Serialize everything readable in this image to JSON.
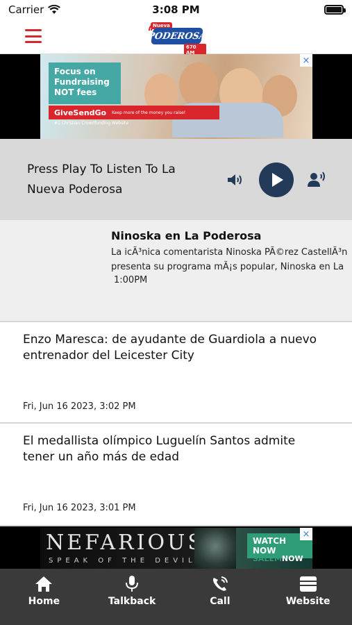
{
  "status_bar": {
    "carrier": "Carrier",
    "time": "3:08 PM"
  },
  "header": {
    "logo_top": "Nueva",
    "logo_main": "PODEROSA",
    "logo_freq": "670 AM",
    "brand_color": "#d8262c",
    "logo_color": "#1e4fa3"
  },
  "ad_top": {
    "headline": "Focus on Fundraising NOT fees",
    "brand": "GiveSendGo",
    "brand_sub": "#1 Christian Crowdfunding Website",
    "tagline": "Keep more of the money you raise!"
  },
  "player": {
    "prompt": "Press Play To Listen To La Nueva Poderosa",
    "button_color": "#233a59"
  },
  "show": {
    "title": "Ninoska en La Poderosa",
    "desc_line1": "La icÃ³nica comentarista Ninoska PÃ©rez CastellÃ³n",
    "desc_line2": "presenta su programa mÃ¡s popular, Ninoska en La",
    "time": "1:00PM"
  },
  "news": [
    {
      "title": "Enzo Maresca: de ayudante de Guardiola a nuevo entrenador del Leicester City",
      "date": "Fri, Jun 16 2023, 3:02 PM"
    },
    {
      "title": "El medallista olímpico Luguelín Santos admite tener un año más de edad",
      "date": "Fri, Jun 16 2023, 3:01 PM"
    }
  ],
  "ad_bottom": {
    "title": "NEFARIOUS",
    "subtitle": "SPEAK OF THE DEVIL",
    "cta": "WATCH NOW",
    "sponsor_a": "SALEM",
    "sponsor_b": "NOW"
  },
  "bottom_nav": {
    "home": "Home",
    "talkback": "Talkback",
    "call": "Call",
    "website": "Website"
  },
  "icons": {
    "ad_close": "×"
  }
}
